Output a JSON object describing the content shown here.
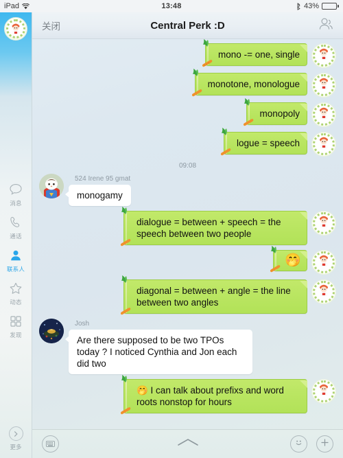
{
  "status_bar": {
    "device": "iPad",
    "wifi_icon": "wifi-icon",
    "time": "13:48",
    "bluetooth_icon": "bluetooth-icon",
    "battery_percent": "43%",
    "battery_level": 43
  },
  "sidebar": {
    "avatar_name": "user-avatar",
    "items": [
      {
        "label": "消息",
        "icon": "chat-bubble-icon",
        "active": false
      },
      {
        "label": "通话",
        "icon": "phone-icon",
        "active": false
      },
      {
        "label": "联系人",
        "icon": "person-icon",
        "active": true
      },
      {
        "label": "动态",
        "icon": "star-icon",
        "active": false
      },
      {
        "label": "发现",
        "icon": "grid-icon",
        "active": false
      }
    ],
    "more": {
      "label": "更多",
      "icon": "chevron-right-circle-icon"
    }
  },
  "navbar": {
    "close_label": "关闭",
    "title": "Central Perk :D",
    "members_icon": "people-icon"
  },
  "conversation": {
    "time_separator": "09:08",
    "messages": [
      {
        "id": "m1",
        "direction": "out",
        "type": "text",
        "text": "mono -= one, single",
        "sender": "",
        "avatar": "wreath"
      },
      {
        "id": "m2",
        "direction": "out",
        "type": "text",
        "text": "monotone, monologue",
        "sender": "",
        "avatar": "wreath"
      },
      {
        "id": "m3",
        "direction": "out",
        "type": "text",
        "text": "monopoly",
        "sender": "",
        "avatar": "wreath"
      },
      {
        "id": "m4",
        "direction": "out",
        "type": "text",
        "text": "logue = speech",
        "sender": "",
        "avatar": "wreath"
      },
      {
        "id": "m5",
        "direction": "in",
        "type": "text",
        "text": "monogamy",
        "sender": "524 Irene 95 gmat",
        "avatar": "hero"
      },
      {
        "id": "m6",
        "direction": "out",
        "type": "text",
        "text": "dialogue = between + speech = the speech between two people",
        "sender": "",
        "avatar": "wreath"
      },
      {
        "id": "m7",
        "direction": "out",
        "type": "emoji",
        "text": "🤭",
        "sender": "",
        "avatar": "wreath"
      },
      {
        "id": "m8",
        "direction": "out",
        "type": "text",
        "text": "diagonal = between + angle = the line between two angles",
        "sender": "",
        "avatar": "wreath"
      },
      {
        "id": "m9",
        "direction": "in",
        "type": "text",
        "text": "Are there supposed to be two TPOs today ? I noticed Cynthia and Jon each did two",
        "sender": "Josh",
        "avatar": "night"
      },
      {
        "id": "m10",
        "direction": "out",
        "type": "text",
        "text": "🤭 I can talk about prefixs and word roots nonstop for hours",
        "sender": "",
        "avatar": "wreath"
      }
    ]
  },
  "toolbar": {
    "keyboard_icon": "keyboard-icon",
    "collapse_icon": "chevron-up-icon",
    "emoji_icon": "smiley-icon",
    "add_icon": "plus-icon"
  },
  "colors": {
    "accent": "#2fa7e8",
    "bubble_out": "#bbe663",
    "bubble_out_border": "#9ccd45",
    "bubble_in": "#ffffff",
    "background": "#dfe8ef"
  }
}
